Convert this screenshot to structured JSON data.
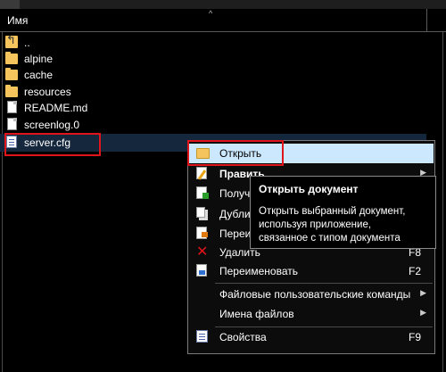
{
  "header": {
    "name_column": "Имя",
    "sort_indicator": "^"
  },
  "files": [
    {
      "name": "..",
      "type": "up"
    },
    {
      "name": "alpine",
      "type": "folder"
    },
    {
      "name": "cache",
      "type": "folder"
    },
    {
      "name": "resources",
      "type": "folder"
    },
    {
      "name": "README.md",
      "type": "file"
    },
    {
      "name": "screenlog.0",
      "type": "file"
    },
    {
      "name": "server.cfg",
      "type": "config"
    }
  ],
  "context_menu": {
    "items": [
      {
        "label": "Открыть",
        "shortcut": "",
        "icon": "folder-open-icon"
      },
      {
        "label": "Править",
        "shortcut": "",
        "icon": "edit-icon",
        "submenu": true
      },
      {
        "label": "Получ",
        "shortcut": "",
        "icon": "get-icon"
      },
      {
        "label": "Дубли",
        "shortcut": "",
        "icon": "duplicate-icon"
      },
      {
        "label": "Переи",
        "shortcut": "",
        "icon": "move-icon"
      },
      {
        "label": "Удалить",
        "shortcut": "F8",
        "icon": "delete-icon"
      },
      {
        "label": "Переименовать",
        "shortcut": "F2",
        "icon": "rename-icon"
      },
      {
        "label": "Файловые пользовательские команды",
        "shortcut": "",
        "icon": "",
        "submenu": true
      },
      {
        "label": "Имена файлов",
        "shortcut": "",
        "icon": "",
        "submenu": true
      },
      {
        "label": "Свойства",
        "shortcut": "F9",
        "icon": "properties-icon"
      }
    ]
  },
  "tooltip": {
    "title": "Открыть документ",
    "body_lines": [
      "Открыть выбранный документ,",
      "используя приложение,",
      "связанное с типом документа"
    ]
  },
  "colors": {
    "highlight": "#cce8ff",
    "annotation_red": "#e0141b",
    "folder": "#f5c45c"
  }
}
